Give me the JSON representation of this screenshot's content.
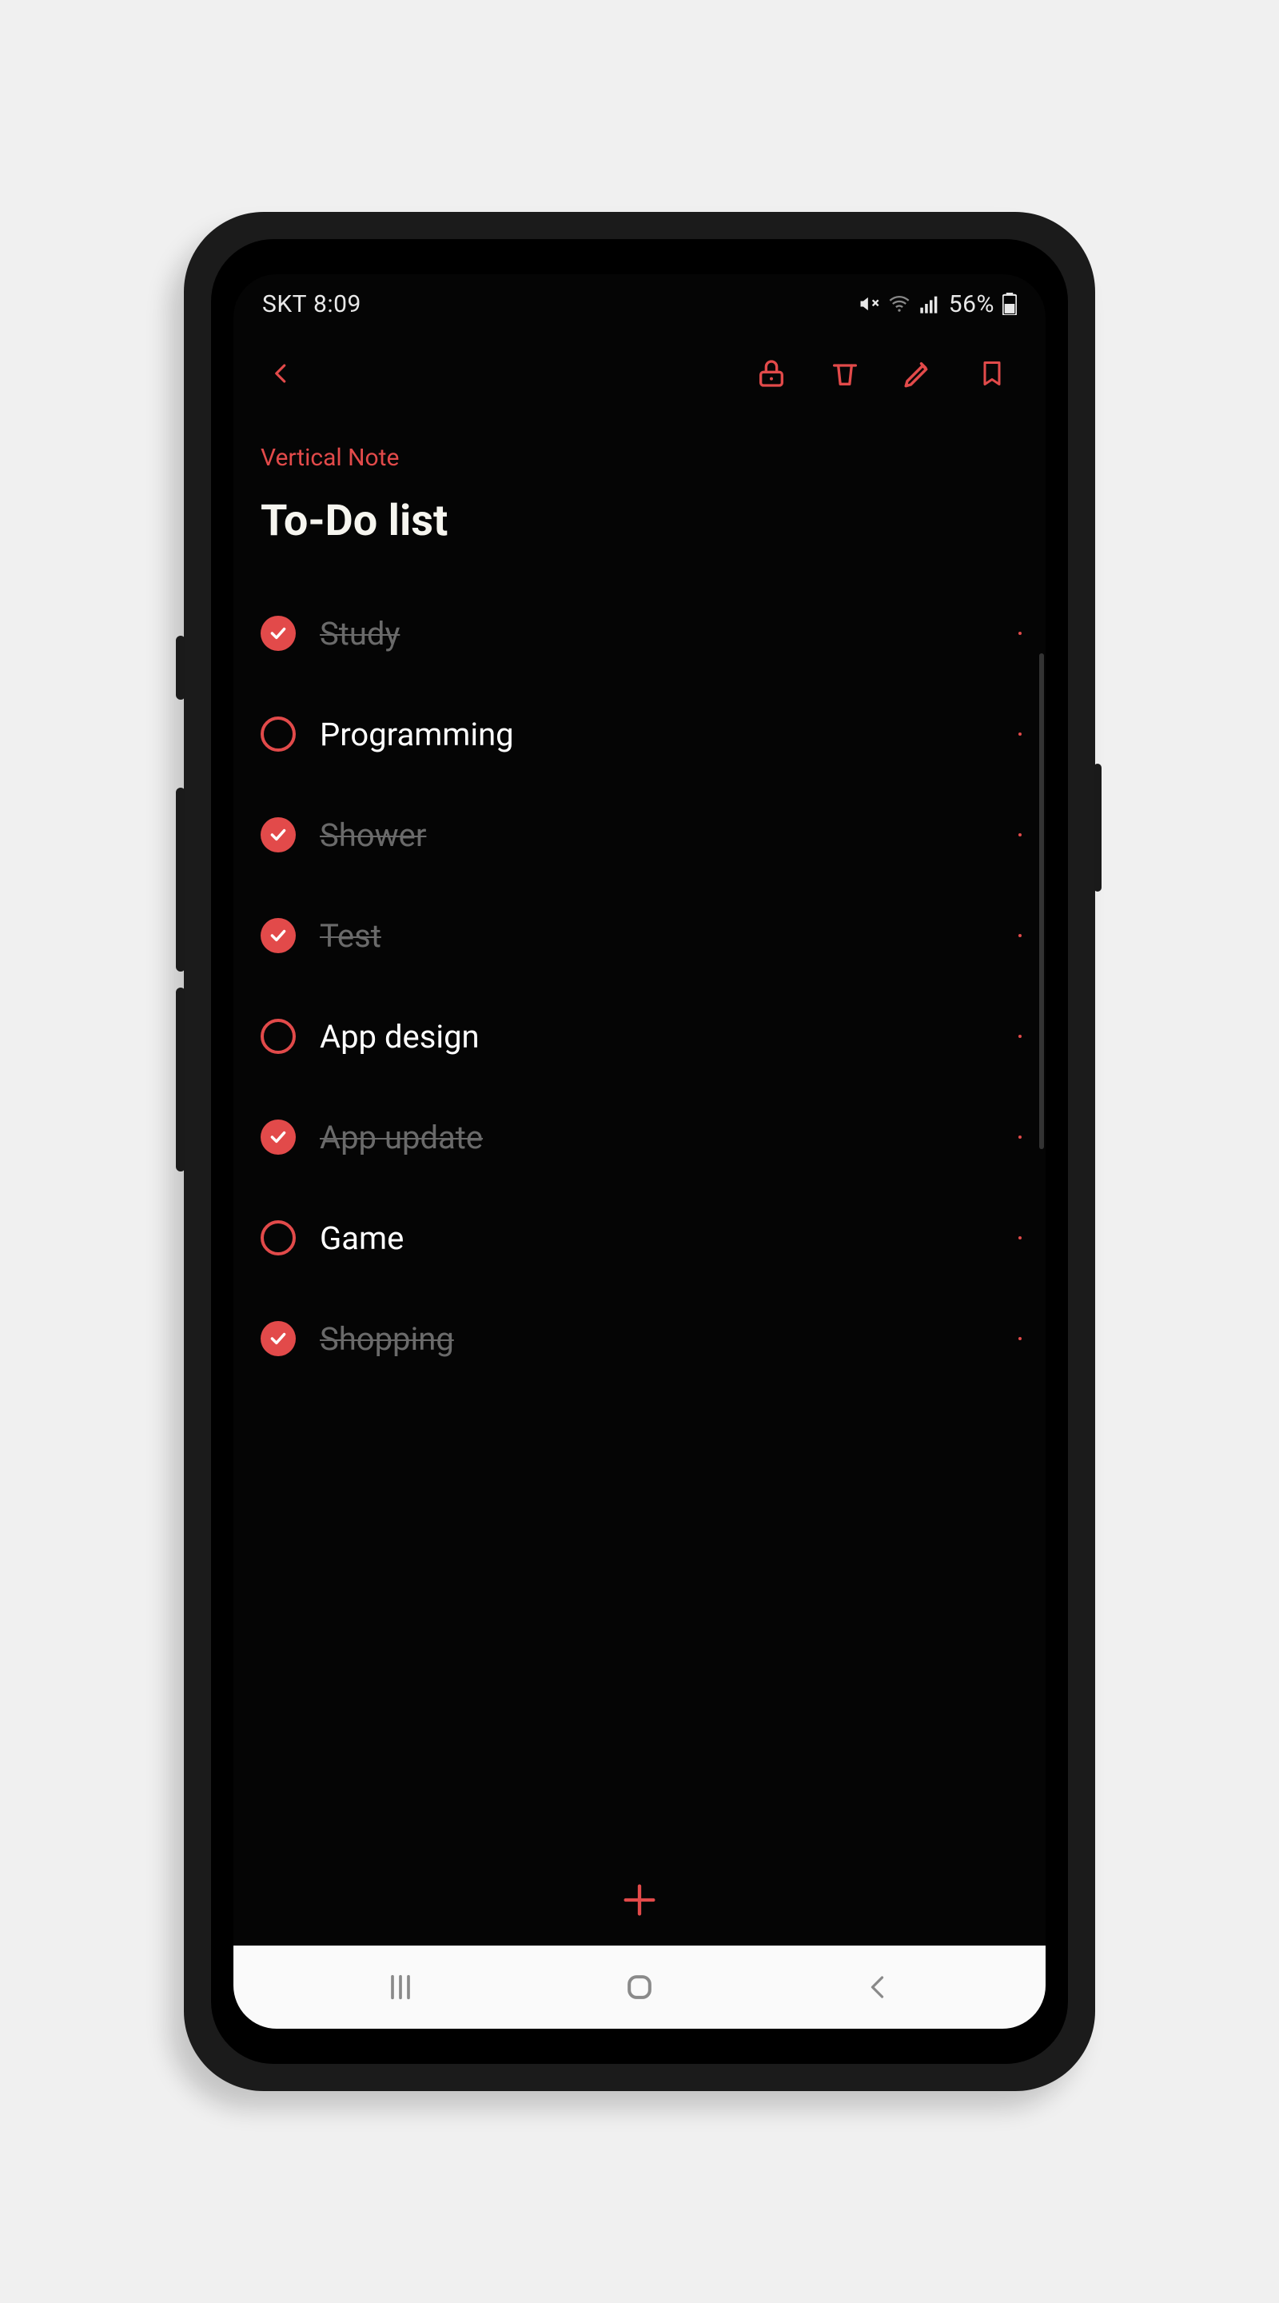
{
  "status": {
    "carrier": "SKT",
    "time": "8:09",
    "battery_pct": "56%"
  },
  "note": {
    "category": "Vertical Note",
    "title": "To-Do list"
  },
  "todos": [
    {
      "label": "Study",
      "done": true
    },
    {
      "label": "Programming",
      "done": false
    },
    {
      "label": "Shower",
      "done": true
    },
    {
      "label": "Test",
      "done": true
    },
    {
      "label": "App design",
      "done": false
    },
    {
      "label": "App update",
      "done": true
    },
    {
      "label": "Game",
      "done": false
    },
    {
      "label": "Shopping",
      "done": true
    }
  ],
  "colors": {
    "accent": "#e24a4a"
  }
}
